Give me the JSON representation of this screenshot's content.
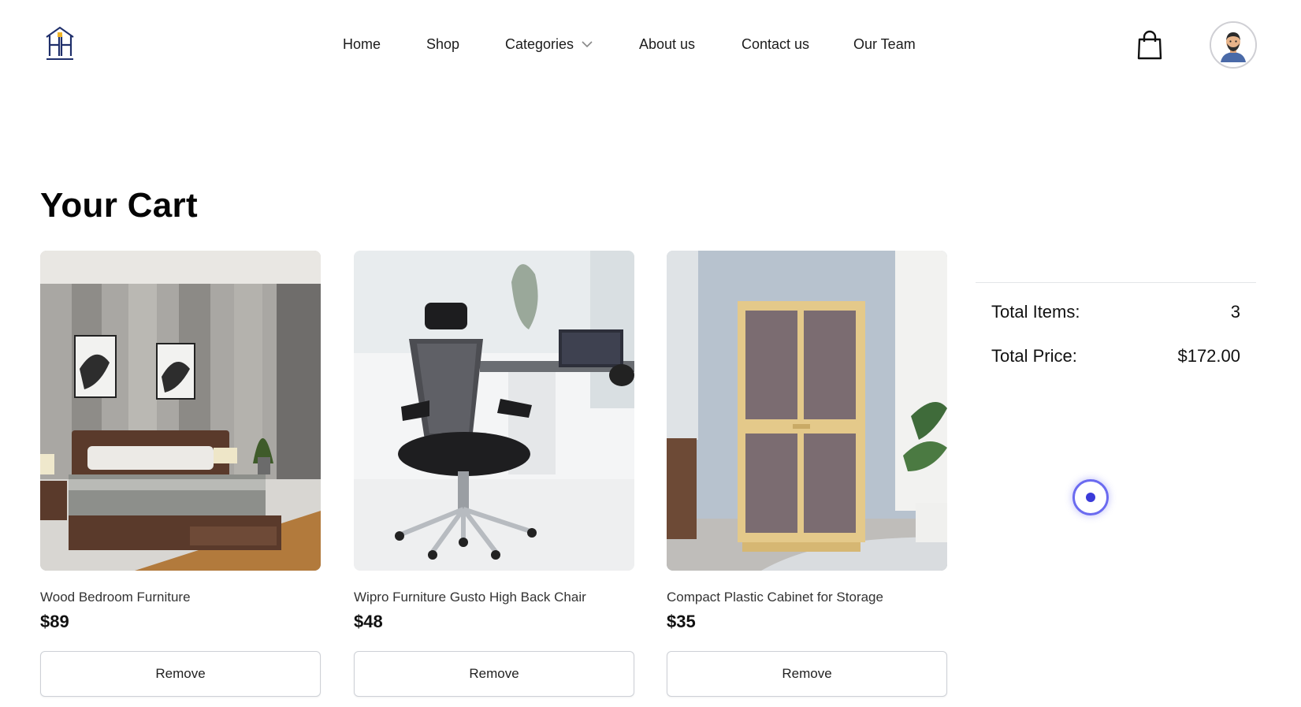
{
  "header": {
    "logo_icon": "furniture-fixture-logo",
    "nav": [
      {
        "label": "Home"
      },
      {
        "label": "Shop"
      },
      {
        "label": "Categories",
        "icon": "chevron-down-icon"
      },
      {
        "label": "About us"
      },
      {
        "label": "Contact us"
      },
      {
        "label": "Our Team"
      }
    ],
    "cart_icon": "shopping-bag-icon",
    "avatar_icon": "user-avatar"
  },
  "main": {
    "title": "Your Cart",
    "items": [
      {
        "name": "Wood Bedroom Furniture",
        "price": "$89",
        "remove_label": "Remove",
        "image": "bedroom-furniture-photo"
      },
      {
        "name": "Wipro Furniture Gusto High Back Chair",
        "price": "$48",
        "remove_label": "Remove",
        "image": "office-chair-photo"
      },
      {
        "name": "Compact Plastic Cabinet for Storage",
        "price": "$35",
        "remove_label": "Remove",
        "image": "storage-cabinet-photo"
      }
    ]
  },
  "summary": {
    "total_items_label": "Total Items:",
    "total_items_value": "3",
    "total_price_label": "Total Price:",
    "total_price_value": "$172.00"
  },
  "colors": {
    "accent": "#5b5be8",
    "button_border": "#cdd0d6",
    "text": "#111111"
  }
}
